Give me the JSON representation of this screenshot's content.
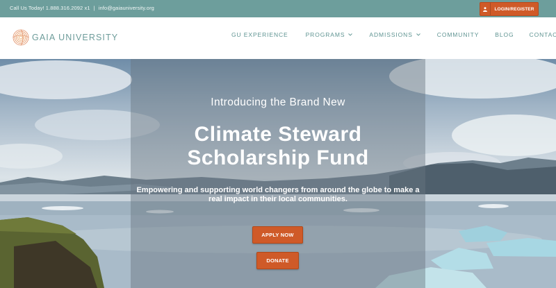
{
  "topbar": {
    "phone": "Call Us Today! 1.888.316.2092 x1",
    "separator": "|",
    "email": "info@gaiauniversity.org",
    "login_label": "LOGIN/REGISTER",
    "login_icon": "user-icon"
  },
  "brand": {
    "name": "GAIA UNIVERSITY",
    "logo_icon": "spiral-logo-icon"
  },
  "nav": {
    "items": [
      {
        "label": "GU EXPERIENCE"
      },
      {
        "label": "PROGRAMS"
      },
      {
        "label": "ADMISSIONS"
      },
      {
        "label": "COMMUNITY"
      },
      {
        "label": "BLOG"
      },
      {
        "label": "CONTACT"
      }
    ]
  },
  "hero": {
    "intro": "Introducing the Brand New",
    "headline_line1": "Climate Steward",
    "headline_line2": "Scholarship Fund",
    "subtext_line1": "Empowering and supporting world changers from around the globe to make a",
    "subtext_line2": "real impact in their local communities.",
    "apply_label": "APPLY NOW",
    "donate_label": "DONATE"
  },
  "colors": {
    "teal": "#6d9e9c",
    "accent": "#cf5a28",
    "nav_text": "#5f9492"
  }
}
